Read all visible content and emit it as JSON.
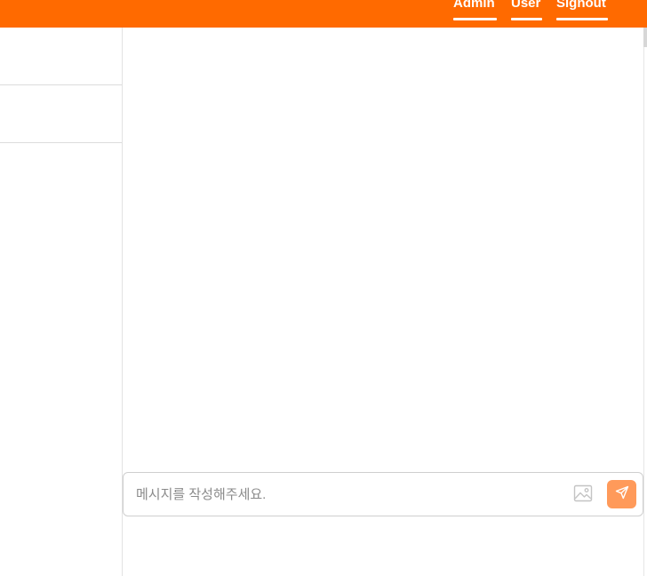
{
  "header": {
    "nav": [
      {
        "label": "Admin"
      },
      {
        "label": "User"
      },
      {
        "label": "Signout"
      }
    ]
  },
  "colors": {
    "brand": "#ff6a00",
    "send_button": "#ff9a5a"
  },
  "composer": {
    "placeholder": "메시지를 작성해주세요.",
    "value": "",
    "image_icon": "image-icon",
    "send_icon": "send-icon"
  }
}
